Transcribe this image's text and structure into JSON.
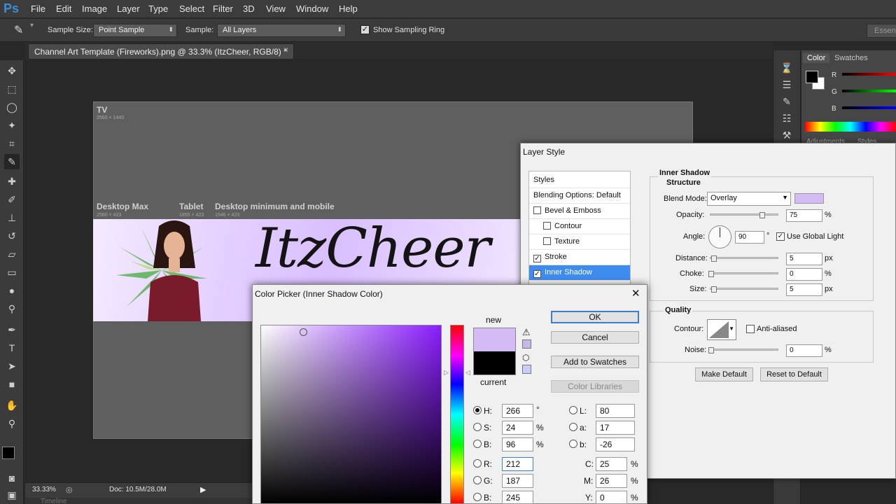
{
  "app": {
    "logo": "Ps"
  },
  "menu": [
    "File",
    "Edit",
    "Image",
    "Layer",
    "Type",
    "Select",
    "Filter",
    "3D",
    "View",
    "Window",
    "Help"
  ],
  "options_bar": {
    "sample_size_label": "Sample Size:",
    "sample_size_value": "Point Sample",
    "sample_label": "Sample:",
    "sample_value": "All Layers",
    "show_ring_label": "Show Sampling Ring",
    "show_ring_checked": true,
    "workspace": "Essent"
  },
  "document": {
    "tab_title": "Channel Art Template (Fireworks).png @ 33.3% (ItzCheer, RGB/8) *",
    "close": "×",
    "tv_label": "TV",
    "tv_size": "2560 × 1440",
    "desktop_max_label": "Desktop Max",
    "desktop_max_size": "2560 × 423",
    "tablet_label": "Tablet",
    "tablet_size": "1855 × 423",
    "desktop_min_label": "Desktop minimum and mobile",
    "desktop_min_size": "1546 × 423",
    "banner_text": "ItzCheer"
  },
  "status": {
    "zoom": "33.33%",
    "doc": "Doc: 10.5M/28.0M",
    "timeline": "Timeline"
  },
  "color_panel": {
    "tabs": [
      "Color",
      "Swatches"
    ],
    "channels": [
      "R",
      "G",
      "B"
    ],
    "adjust_tabs": [
      "Adjustments",
      "Styles"
    ]
  },
  "layer_style": {
    "title": "Layer Style",
    "list": [
      {
        "label": "Styles",
        "checkbox": false
      },
      {
        "label": "Blending Options: Default",
        "checkbox": false
      },
      {
        "label": "Bevel & Emboss",
        "checkbox": true,
        "checked": false
      },
      {
        "label": "Contour",
        "checkbox": true,
        "checked": false,
        "indent": true
      },
      {
        "label": "Texture",
        "checkbox": true,
        "checked": false,
        "indent": true
      },
      {
        "label": "Stroke",
        "checkbox": true,
        "checked": true
      },
      {
        "label": "Inner Shadow",
        "checkbox": true,
        "checked": true,
        "selected": true
      }
    ],
    "section": "Inner Shadow",
    "structure": "Structure",
    "blend_mode_label": "Blend Mode:",
    "blend_mode": "Overlay",
    "shadow_color": "#d4bbf5",
    "opacity_label": "Opacity:",
    "opacity": "75",
    "angle_label": "Angle:",
    "angle": "90",
    "degree": "°",
    "use_global_light": "Use Global Light",
    "distance_label": "Distance:",
    "distance": "5",
    "choke_label": "Choke:",
    "choke": "0",
    "size_label": "Size:",
    "size": "5",
    "px": "px",
    "percent": "%",
    "quality": "Quality",
    "contour_label": "Contour:",
    "anti_aliased": "Anti-aliased",
    "noise_label": "Noise:",
    "noise": "0",
    "make_default": "Make Default",
    "reset_default": "Reset to Default"
  },
  "color_picker": {
    "title": "Color Picker (Inner Shadow Color)",
    "close": "✕",
    "new_label": "new",
    "current_label": "current",
    "new_color": "#d4bbf5",
    "current_color": "#000000",
    "ok": "OK",
    "cancel": "Cancel",
    "add_swatches": "Add to Swatches",
    "color_libraries": "Color Libraries",
    "H": "266",
    "S": "24",
    "B": "96",
    "R": "212",
    "G": "187",
    "Bl": "245",
    "L": "80",
    "a": "17",
    "b": "-26",
    "C": "25",
    "M": "26",
    "Y": "0",
    "deg": "°",
    "pct": "%",
    "labels": {
      "H": "H:",
      "S": "S:",
      "B": "B:",
      "R": "R:",
      "G": "G:",
      "Bl": "B:",
      "L": "L:",
      "a": "a:",
      "b": "b:",
      "C": "C:",
      "M": "M:",
      "Y": "Y:"
    }
  }
}
